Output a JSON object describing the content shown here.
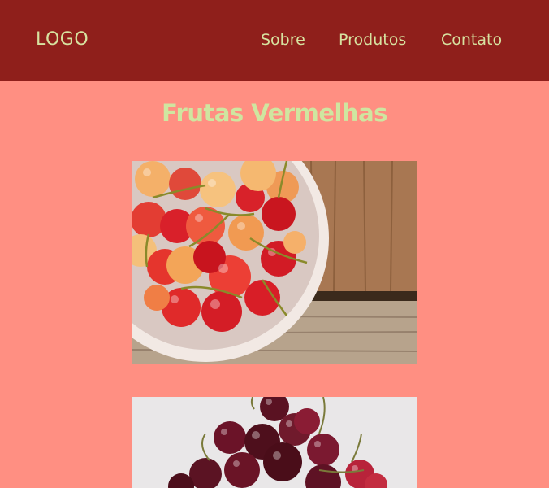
{
  "header": {
    "logo": "LOGO",
    "nav": [
      {
        "label": "Sobre"
      },
      {
        "label": "Produtos"
      },
      {
        "label": "Contato"
      }
    ]
  },
  "main": {
    "title": "Frutas Vermelhas",
    "images": [
      {
        "subject": "cherries-in-bowl"
      },
      {
        "subject": "dark-cherries-pile"
      }
    ]
  },
  "colors": {
    "header_bg": "#8f1f1b",
    "page_bg": "#ff8f82",
    "nav_text": "#d7e2a0",
    "title_text": "#cfe6a0"
  }
}
